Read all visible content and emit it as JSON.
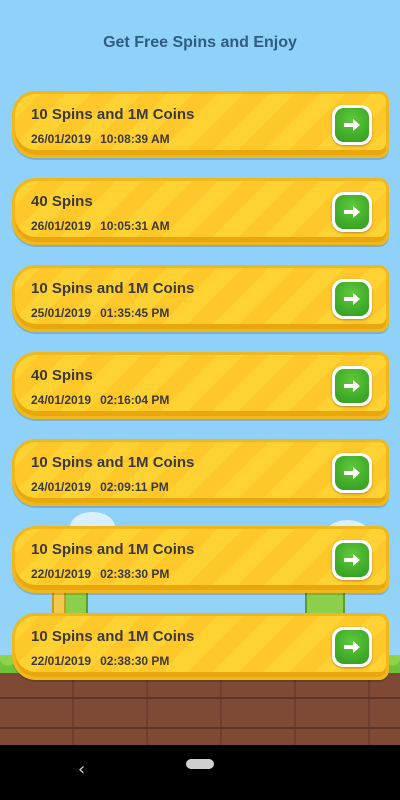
{
  "page": {
    "title": "Get Free Spins and Enjoy"
  },
  "rewards": [
    {
      "title": "10 Spins and 1M Coins",
      "date": "26/01/2019",
      "time": "10:08:39 AM"
    },
    {
      "title": "40 Spins",
      "date": "26/01/2019",
      "time": "10:05:31 AM"
    },
    {
      "title": "10 Spins and 1M Coins",
      "date": "25/01/2019",
      "time": "01:35:45 PM"
    },
    {
      "title": "40 Spins",
      "date": "24/01/2019",
      "time": "02:16:04 PM"
    },
    {
      "title": "10 Spins and 1M Coins",
      "date": "24/01/2019",
      "time": "02:09:11 PM"
    },
    {
      "title": "10 Spins and 1M Coins",
      "date": "22/01/2019",
      "time": "02:38:30 PM"
    },
    {
      "title": "10 Spins and 1M Coins",
      "date": "22/01/2019",
      "time": "02:38:30 PM"
    }
  ],
  "icons": {
    "go": "arrow-right-icon",
    "nav_back": "back-chevron-icon",
    "nav_home": "home-pill-icon"
  },
  "colors": {
    "card": "#ffd233",
    "button": "#3aa828",
    "title": "#2f5d82"
  }
}
